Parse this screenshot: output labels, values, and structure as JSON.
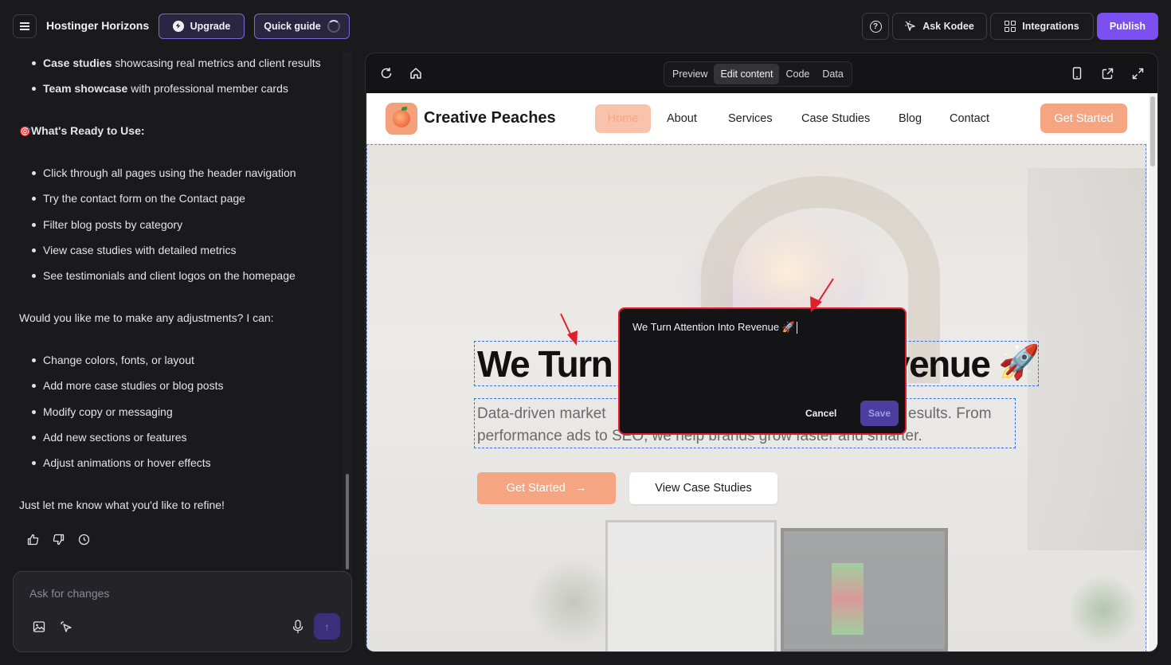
{
  "topbar": {
    "brand": "Hostinger Horizons",
    "upgrade_label": "Upgrade",
    "quick_guide_label": "Quick guide",
    "ask_kodee_label": "Ask Kodee",
    "integrations_label": "Integrations",
    "publish_label": "Publish"
  },
  "chat": {
    "top_bullets": [
      {
        "bold": "Case studies",
        "rest": " showcasing real metrics and client results"
      },
      {
        "bold": "Team showcase",
        "rest": " with professional member cards"
      }
    ],
    "ready_heading": "What's Ready to Use:",
    "ready_icon": "🎯",
    "ready_items": [
      "Click through all pages using the header navigation",
      "Try the contact form on the Contact page",
      "Filter blog posts by category",
      "View case studies with detailed metrics",
      "See testimonials and client logos on the homepage"
    ],
    "question": "Would you like me to make any adjustments? I can:",
    "adjust_items": [
      "Change colors, fonts, or layout",
      "Add more case studies or blog posts",
      "Modify copy or messaging",
      "Add new sections or features",
      "Adjust animations or hover effects"
    ],
    "closing": "Just let me know what you'd like to refine!",
    "input_placeholder": "Ask for changes"
  },
  "preview": {
    "tabs": [
      "Preview",
      "Edit content",
      "Code",
      "Data"
    ],
    "active_tab": "Edit content"
  },
  "site": {
    "name": "Creative Peaches",
    "nav": [
      "Home",
      "About",
      "Services",
      "Case Studies",
      "Blog",
      "Contact"
    ],
    "cta": "Get Started",
    "hero_title_left": "We Turn",
    "hero_title_right": "venue",
    "hero_rocket": "🚀",
    "hero_sub_line1_left": "Data-driven market",
    "hero_sub_line1_right": "esults. From",
    "hero_sub_line2": "performance ads to SEO, we help brands grow faster and smarter.",
    "btn_primary": "Get Started",
    "btn_secondary": "View Case Studies"
  },
  "edit_popup": {
    "value": "We Turn Attention Into Revenue 🚀",
    "cancel_label": "Cancel",
    "save_label": "Save"
  },
  "colors": {
    "accent": "#7c4ff0",
    "peach": "#f6a583",
    "highlight": "#e01f2a"
  }
}
